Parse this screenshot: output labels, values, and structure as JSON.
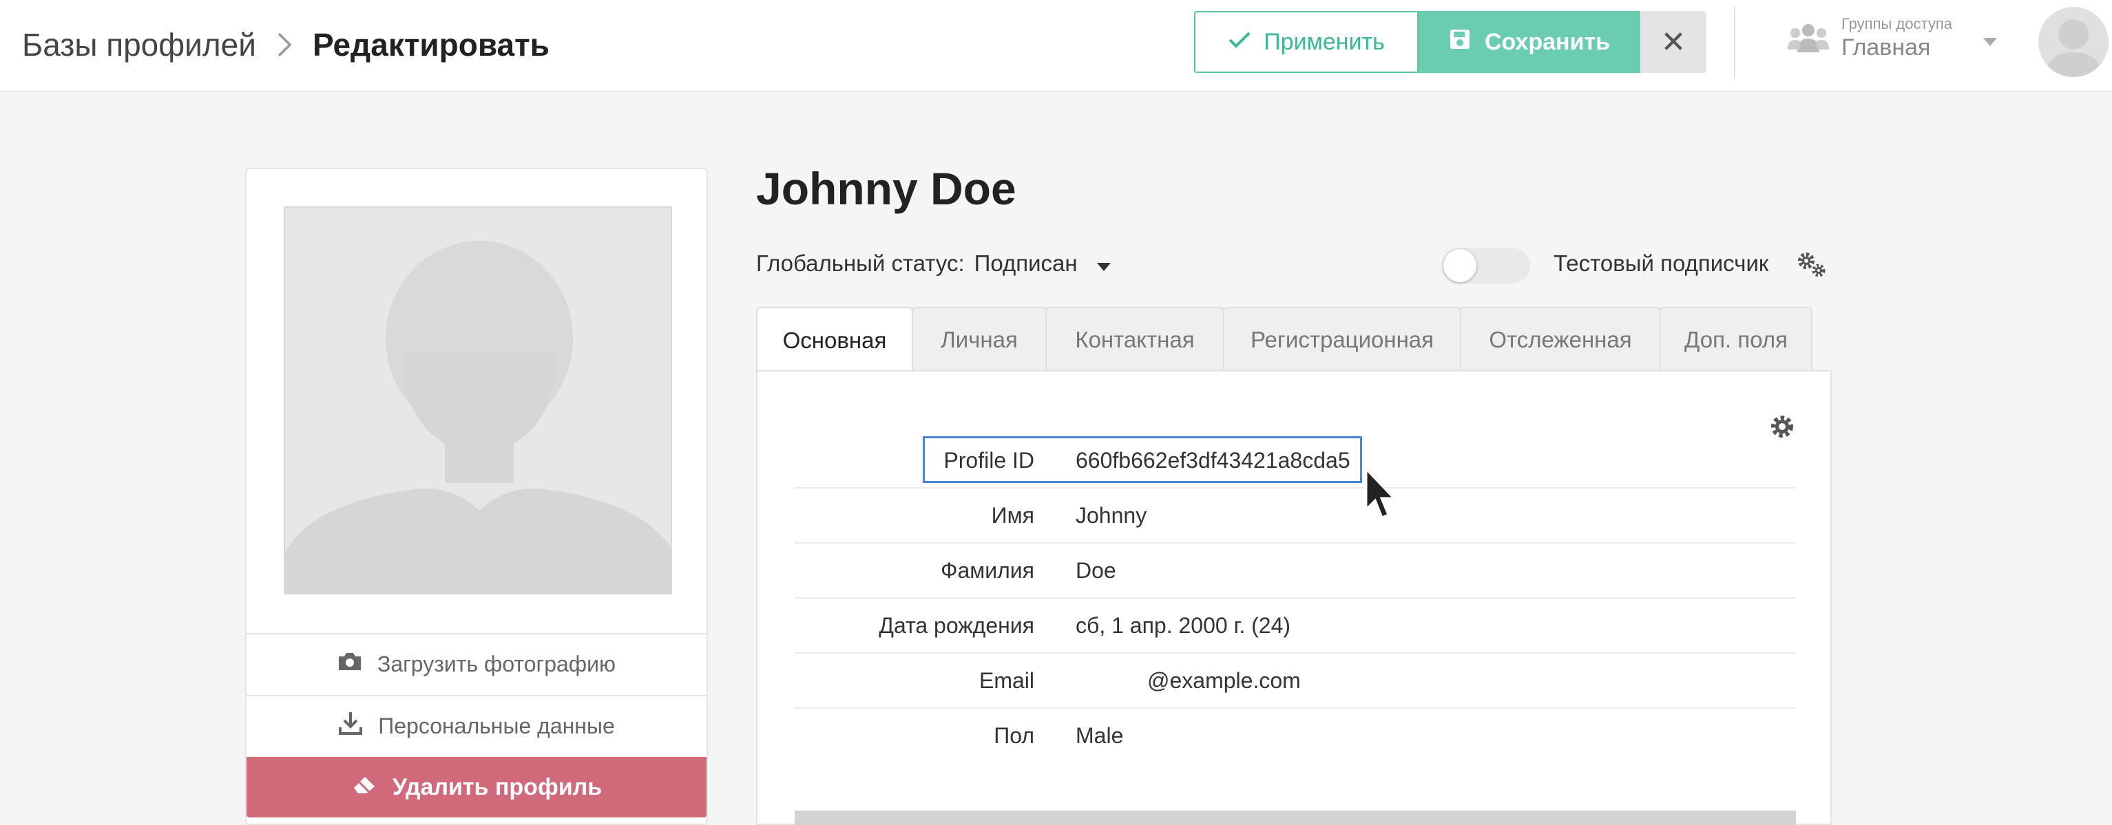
{
  "header": {
    "breadcrumb_root": "Базы профилей",
    "breadcrumb_current": "Редактировать",
    "apply_label": "Применить",
    "save_label": "Сохранить",
    "close_label": "✕",
    "access_groups_label": "Группы доступа",
    "access_groups_value": "Главная"
  },
  "left_panel": {
    "upload_photo_label": "Загрузить фотографию",
    "personal_data_label": "Персональные данные",
    "delete_profile_label": "Удалить профиль"
  },
  "profile": {
    "name": "Johnny Doe",
    "global_status_label": "Глобальный статус:",
    "global_status_value": "Подписан",
    "test_subscriber_label": "Тестовый подписчик",
    "test_subscriber_on": false
  },
  "tabs": [
    {
      "label": "Основная",
      "active": true
    },
    {
      "label": "Личная",
      "active": false
    },
    {
      "label": "Контактная",
      "active": false
    },
    {
      "label": "Регистрационная",
      "active": false
    },
    {
      "label": "Отслеженная",
      "active": false
    },
    {
      "label": "Доп. поля",
      "active": false
    }
  ],
  "fields": [
    {
      "label": "Profile ID",
      "value": "660fb662ef3df43421a8cda5"
    },
    {
      "label": "Имя",
      "value": "Johnny"
    },
    {
      "label": "Фамилия",
      "value": "Doe"
    },
    {
      "label": "Дата рождения",
      "value": "сб, 1 апр. 2000 г. (24)"
    },
    {
      "label": "Email",
      "value": "@example.com"
    },
    {
      "label": "Пол",
      "value": "Male"
    }
  ],
  "colors": {
    "accent": "#6bcdb0",
    "danger": "#d0697a",
    "focus": "#4a86d8"
  }
}
